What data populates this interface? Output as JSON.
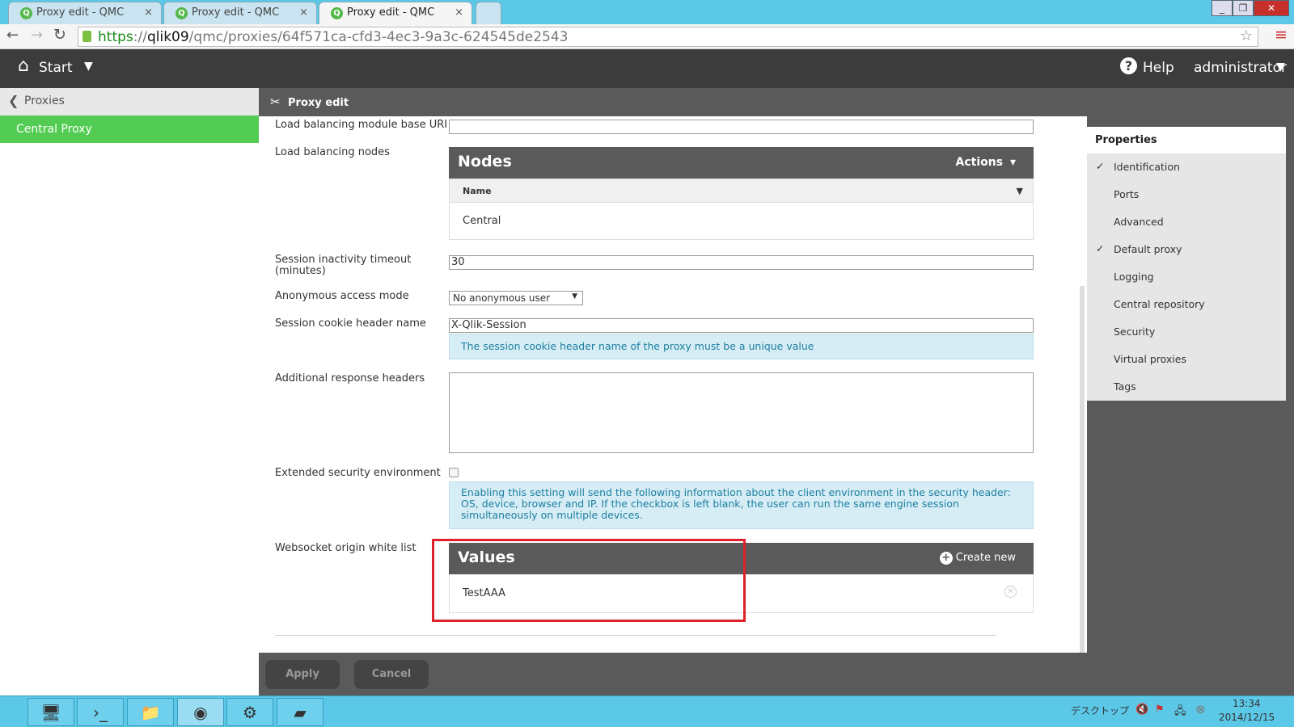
{
  "browser": {
    "tabs": [
      {
        "title": "Proxy edit - QMC"
      },
      {
        "title": "Proxy edit - QMC"
      },
      {
        "title": "Proxy edit - QMC",
        "active": true
      }
    ],
    "url": {
      "scheme": "https",
      "sep": "://",
      "host": "qlik09",
      "path": "/qmc/proxies/64f571ca-cfd3-4ec3-9a3c-624545de2543"
    }
  },
  "header": {
    "start": "Start",
    "help": "Help",
    "user": "administrator"
  },
  "sidebar": {
    "back": "Proxies",
    "selected": "Central Proxy"
  },
  "subheader": {
    "title": "Proxy edit"
  },
  "form": {
    "lb_uri_label": "Load balancing module base URI",
    "lb_uri_value": "",
    "lb_nodes_label": "Load balancing nodes",
    "nodes": {
      "title": "Nodes",
      "actions": "Actions",
      "column": "Name",
      "rows": [
        "Central"
      ]
    },
    "timeout_label": "Session inactivity timeout (minutes)",
    "timeout_value": "30",
    "anon_label": "Anonymous access mode",
    "anon_value": "No anonymous user",
    "cookie_label": "Session cookie header name",
    "cookie_value": "X-Qlik-Session",
    "cookie_info": "The session cookie header name of the proxy must be a unique value",
    "headers_label": "Additional response headers",
    "headers_value": "",
    "ext_label": "Extended security environment",
    "ext_checked": false,
    "ext_info": "Enabling this setting will send the following information about the client environment in the security header: OS, device, browser and IP. If the checkbox is left blank, the user can run the same engine session simultaneously on multiple devices.",
    "ws_label": "Websocket origin white list",
    "values": {
      "title": "Values",
      "create": "Create new",
      "rows": [
        "TestAAA"
      ]
    }
  },
  "properties": {
    "title": "Properties",
    "items": [
      {
        "label": "Identification",
        "checked": true
      },
      {
        "label": "Ports",
        "checked": false
      },
      {
        "label": "Advanced",
        "checked": false
      },
      {
        "label": "Default proxy",
        "checked": true
      },
      {
        "label": "Logging",
        "checked": false
      },
      {
        "label": "Central repository",
        "checked": false
      },
      {
        "label": "Security",
        "checked": false
      },
      {
        "label": "Virtual proxies",
        "checked": false
      },
      {
        "label": "Tags",
        "checked": false
      }
    ]
  },
  "footer": {
    "apply": "Apply",
    "cancel": "Cancel"
  },
  "taskbar": {
    "desktop": "デスクトップ",
    "time": "13:34",
    "date": "2014/12/15"
  },
  "colors": {
    "accent_green": "#52cc52",
    "highlight_red": "#e0202a",
    "header": "#3c3c3c"
  }
}
